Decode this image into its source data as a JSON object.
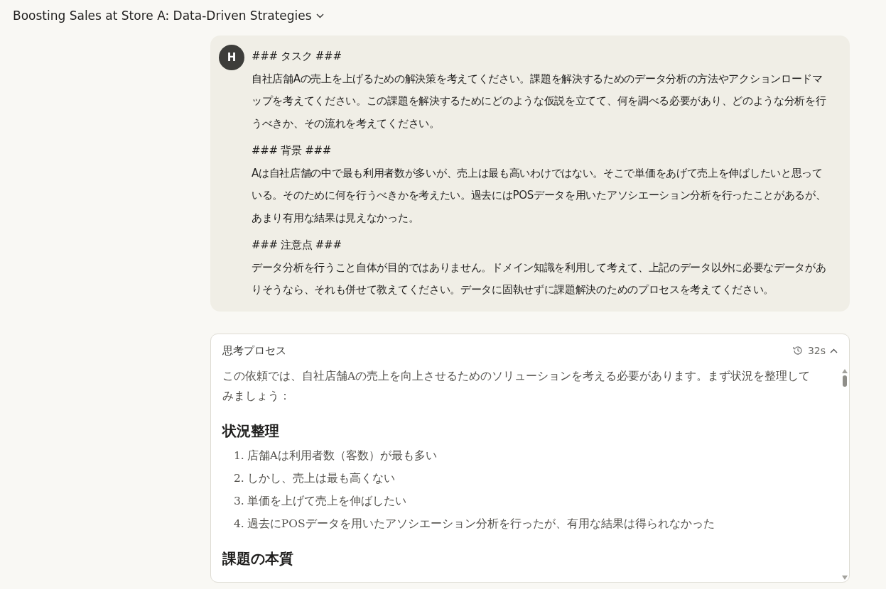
{
  "conversation_title": "Boosting Sales at Store A: Data-Driven Strategies",
  "user_message": {
    "avatar_initial": "H",
    "sections": [
      {
        "heading": "### タスク ###",
        "body": "自社店舗Aの売上を上げるための解決策を考えてください。課題を解決するためのデータ分析の方法やアクションロードマップを考えてください。この課題を解決するためにどのような仮説を立てて、何を調べる必要があり、どのような分析を行うべきか、その流れを考えてください。"
      },
      {
        "heading": "### 背景 ###",
        "body": "Aは自社店舗の中で最も利用者数が多いが、売上は最も高いわけではない。そこで単価をあげて売上を伸ばしたいと思っている。そのために何を行うべきかを考えたい。過去にはPOSデータを用いたアソシエーション分析を行ったことがあるが、あまり有用な結果は見えなかった。"
      },
      {
        "heading": "### 注意点 ###",
        "body": "データ分析を行うこと自体が目的ではありません。ドメイン知識を利用して考えて、上記のデータ以外に必要なデータがありそうなら、それも併せて教えてください。データに固執せずに課題解決のためのプロセスを考えてください。"
      }
    ]
  },
  "thinking": {
    "label": "思考プロセス",
    "duration": "32s",
    "expanded": true,
    "blocks": [
      {
        "kind": "paragraph",
        "text": "この依頼では、自社店舗Aの売上を向上させるためのソリューションを考える必要があります。まず状況を整理してみましょう："
      },
      {
        "kind": "heading",
        "text": "状況整理"
      },
      {
        "kind": "list",
        "items": [
          {
            "number": "1.",
            "text": "店舗Aは利用者数（客数）が最も多い"
          },
          {
            "number": "2.",
            "text": "しかし、売上は最も高くない"
          },
          {
            "number": "3.",
            "text": "単価を上げて売上を伸ばしたい"
          },
          {
            "number": "4.",
            "text": "過去にPOSデータを用いたアソシエーション分析を行ったが、有用な結果は得られなかった"
          }
        ]
      },
      {
        "kind": "heading",
        "text": "課題の本質"
      }
    ]
  }
}
